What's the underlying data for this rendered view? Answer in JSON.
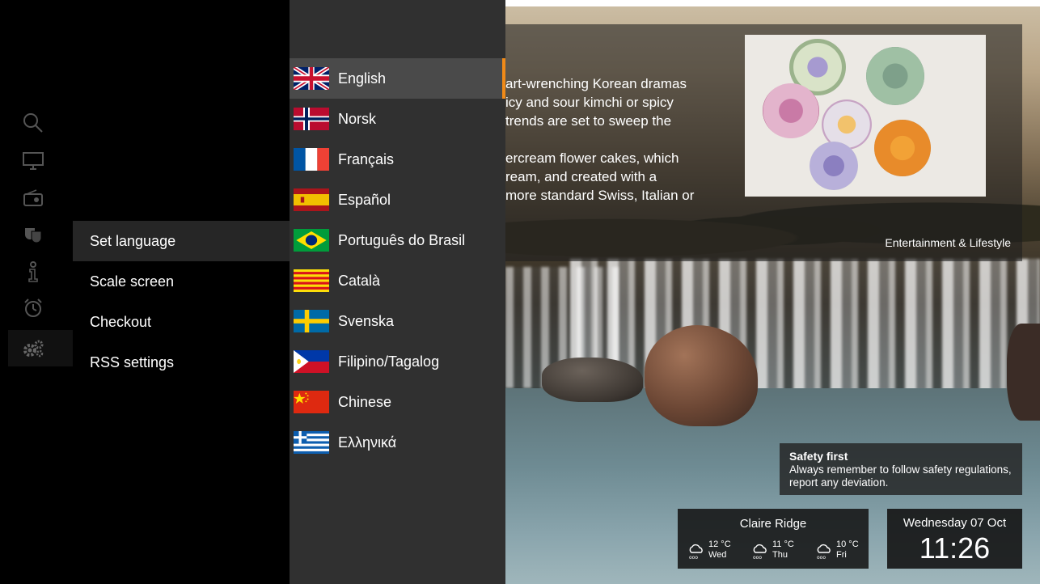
{
  "settings_menu": {
    "items": [
      {
        "label": "Set language"
      },
      {
        "label": "Scale screen"
      },
      {
        "label": "Checkout"
      },
      {
        "label": "RSS settings"
      }
    ]
  },
  "icon_rail": {
    "icons": [
      "search-icon",
      "tv-icon",
      "radio-icon",
      "theater-masks-icon",
      "info-icon",
      "alarm-clock-icon",
      "settings-gears-icon"
    ]
  },
  "language_panel": {
    "languages": [
      {
        "label": "English",
        "flag": "uk-flag-icon"
      },
      {
        "label": "Norsk",
        "flag": "norway-flag-icon"
      },
      {
        "label": "Français",
        "flag": "france-flag-icon"
      },
      {
        "label": "Español",
        "flag": "spain-flag-icon"
      },
      {
        "label": "Português do Brasil",
        "flag": "brazil-flag-icon"
      },
      {
        "label": "Català",
        "flag": "catalonia-flag-icon"
      },
      {
        "label": "Svenska",
        "flag": "sweden-flag-icon"
      },
      {
        "label": "Filipino/Tagalog",
        "flag": "philippines-flag-icon"
      },
      {
        "label": "Chinese",
        "flag": "china-flag-icon"
      },
      {
        "label": "Ελληνικά",
        "flag": "greece-flag-icon"
      }
    ],
    "accent_color": "#f08a18"
  },
  "news": {
    "text": "art-wrenching Korean dramas\nicy and sour kimchi or spicy\ntrends are set to sweep the\n\nercream flower cakes, which\nream, and created with a\nmore standard Swiss, Italian or",
    "category": "Entertainment & Lifestyle"
  },
  "info": {
    "title": "Safety first",
    "body": "Always remember to follow safety regulations, report any deviation."
  },
  "weather": {
    "location": "Claire Ridge",
    "forecast": [
      {
        "temp": "12 °C",
        "day": "Wed"
      },
      {
        "temp": "11 °C",
        "day": "Thu"
      },
      {
        "temp": "10 °C",
        "day": "Fri"
      }
    ]
  },
  "clock": {
    "date": "Wednesday 07 Oct",
    "time": "11:26"
  }
}
